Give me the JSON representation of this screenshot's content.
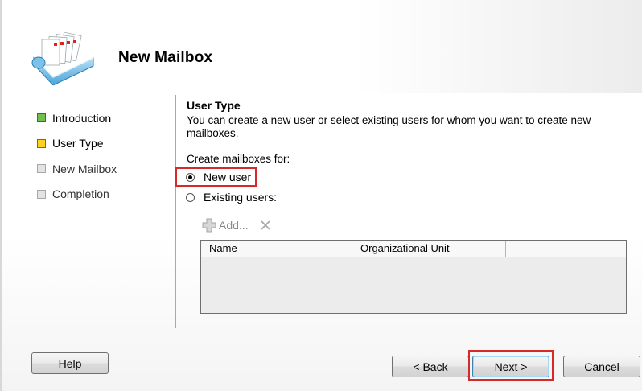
{
  "header": {
    "title": "New Mailbox",
    "icon": "mailbox-stack-icon"
  },
  "steps": [
    {
      "label": "Introduction",
      "state": "completed",
      "color": "#6fc04e"
    },
    {
      "label": "User Type",
      "state": "current",
      "color": "#ffd21e"
    },
    {
      "label": "New Mailbox",
      "state": "pending",
      "color": "#e3e3e3"
    },
    {
      "label": "Completion",
      "state": "pending",
      "color": "#e3e3e3"
    }
  ],
  "content": {
    "section_title": "User Type",
    "description": "You can create a new user or select existing users for whom you want to create new mailboxes.",
    "create_for_label": "Create mailboxes for:",
    "options": [
      {
        "label": "New user",
        "checked": true
      },
      {
        "label": "Existing users:",
        "checked": false
      }
    ],
    "toolbar": {
      "add_label": "Add...",
      "add_icon": "add-icon",
      "delete_icon": "delete-x-icon"
    },
    "grid": {
      "columns": [
        "Name",
        "Organizational Unit",
        ""
      ],
      "rows": []
    }
  },
  "buttons": {
    "help": "Help",
    "back": "< Back",
    "next": "Next >",
    "cancel": "Cancel"
  },
  "highlight_color": "#d62a2a"
}
